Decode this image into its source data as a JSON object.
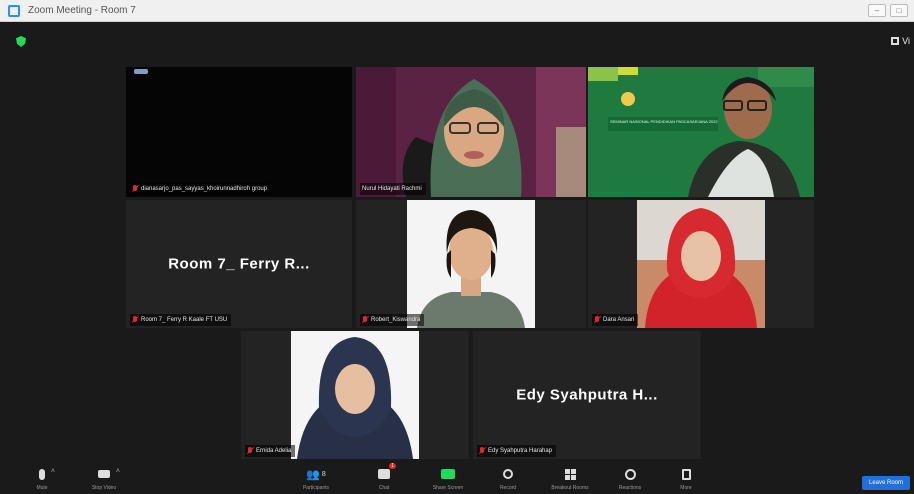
{
  "window": {
    "title": "Zoom Meeting - Room 7"
  },
  "view_button": {
    "label": "Vi"
  },
  "participants": [
    {
      "id": "p1",
      "name": "dianasarjo_pas_sayyas_khoirunnadhiroh group",
      "video": "dark",
      "muted": true
    },
    {
      "id": "p2",
      "name": "Nurul Hidayati Rachmi",
      "video": "camera",
      "muted": false,
      "active_speaker": true
    },
    {
      "id": "p3",
      "name": "",
      "video": "camera",
      "muted": false,
      "banner": "SEMINAR NASIONAL PENDIDIKAN PASCASARJANA 2022"
    },
    {
      "id": "p4",
      "name": "Room 7_ Ferry R Kaale FT USU",
      "display_text": "Room 7_ Ferry R...",
      "video": "off",
      "muted": true
    },
    {
      "id": "p5",
      "name": "Robert_Kiswandra",
      "video": "photo",
      "muted": true
    },
    {
      "id": "p6",
      "name": "Dara Ansari",
      "video": "photo",
      "muted": true
    },
    {
      "id": "p7",
      "name": "Ernida Adelia",
      "video": "photo",
      "muted": true
    },
    {
      "id": "p8",
      "name": "Edy Syahputra Harahap",
      "display_text": "Edy Syahputra H...",
      "video": "off",
      "muted": true
    }
  ],
  "toolbar": {
    "mute": "Mute",
    "stop_video": "Stop Video",
    "participants": "Participants",
    "participants_count": "8",
    "chat": "Chat",
    "chat_badge": "1",
    "share_screen": "Share Screen",
    "record": "Record",
    "breakout_rooms": "Breakout Rooms",
    "reactions": "Reactions",
    "more": "More",
    "leave": "Leave Room"
  },
  "colors": {
    "active_border": "#e8e038",
    "share_green": "#23d959",
    "leave_blue": "#1f6fdc",
    "muted_red": "#e02828"
  }
}
